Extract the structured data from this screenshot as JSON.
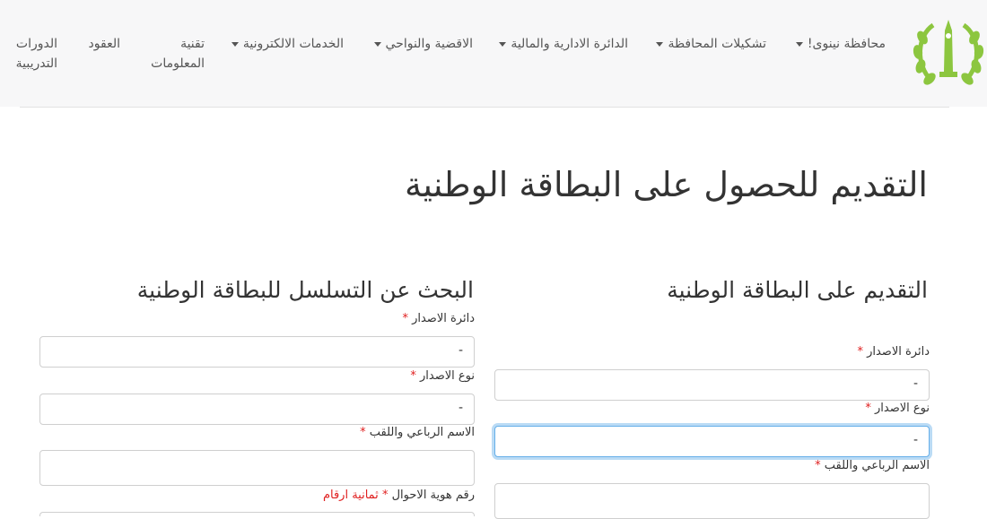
{
  "nav": {
    "brand": "محافظة نينوى!",
    "items": [
      {
        "label": "تشكيلات المحافظة"
      },
      {
        "label": "الدائرة الادارية والمالية"
      },
      {
        "label": "الاقضية والنواحي"
      },
      {
        "label": "الخدمات الالكترونية"
      },
      {
        "label_line1": "تقنية",
        "label_line2": "المعلومات"
      },
      {
        "label": "العقود"
      },
      {
        "label_line1": "الدورات",
        "label_line2": "التدريبية"
      }
    ],
    "logo_icon": "green-laurel-monument-logo"
  },
  "page_title": "التقديم للحصول على البطاقة الوطنية",
  "apply_form": {
    "title": "التقديم على البطاقة الوطنية",
    "issue_office_label": "دائرة الاصدار",
    "issue_office_value": "-",
    "issue_type_label": "نوع الاصدار",
    "issue_type_value": "-",
    "full_name_label": "الاسم الرباعي واللقب",
    "full_name_value": ""
  },
  "search_form": {
    "title": "البحث عن التسلسل للبطاقة الوطنية",
    "issue_office_label": "دائرة الاصدار",
    "issue_office_value": "-",
    "issue_type_label": "نوع الاصدار",
    "issue_type_value": "-",
    "full_name_label": "الاسم الرباعي واللقب",
    "full_name_value": "",
    "civil_id_label": "رقم هوية الاحوال",
    "civil_id_hint": "ثمانية ارقام"
  },
  "required_mark": "*",
  "colors": {
    "required": "#e02020",
    "focus": "#66afe9",
    "logo": "#8cc63f"
  }
}
